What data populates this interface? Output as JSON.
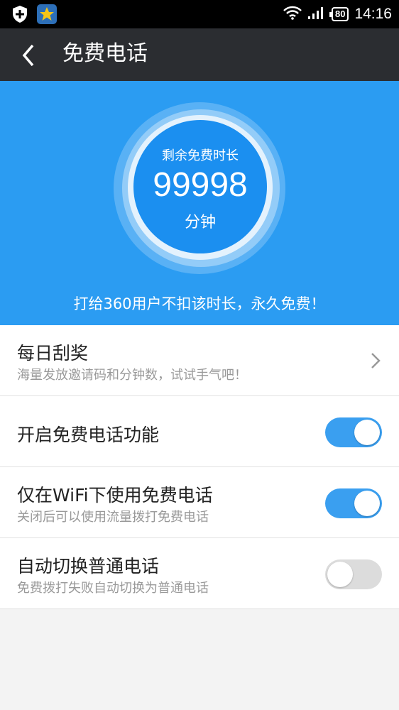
{
  "status_bar": {
    "battery": "80",
    "time": "14:16"
  },
  "header": {
    "title": "免费电话"
  },
  "hero": {
    "remaining_label": "剩余免费时长",
    "remaining_value": "99998",
    "unit": "分钟",
    "caption": "打给360用户不扣该时长，永久免费！"
  },
  "settings": {
    "daily_draw": {
      "title": "每日刮奖",
      "subtitle": "海量发放邀请码和分钟数，试试手气吧！"
    },
    "enable_free_call": {
      "title": "开启免费电话功能",
      "on": true
    },
    "wifi_only": {
      "title": "仅在WiFi下使用免费电话",
      "subtitle": "关闭后可以使用流量拨打免费电话",
      "on": true
    },
    "auto_switch": {
      "title": "自动切换普通电话",
      "subtitle": "免费拨打失败自动切换为普通电话",
      "on": false
    }
  },
  "colors": {
    "accent": "#2b9cf2",
    "header_bg": "#2b2d31",
    "toggle_on": "#3a9ff0",
    "toggle_off": "#dcdcdc"
  }
}
